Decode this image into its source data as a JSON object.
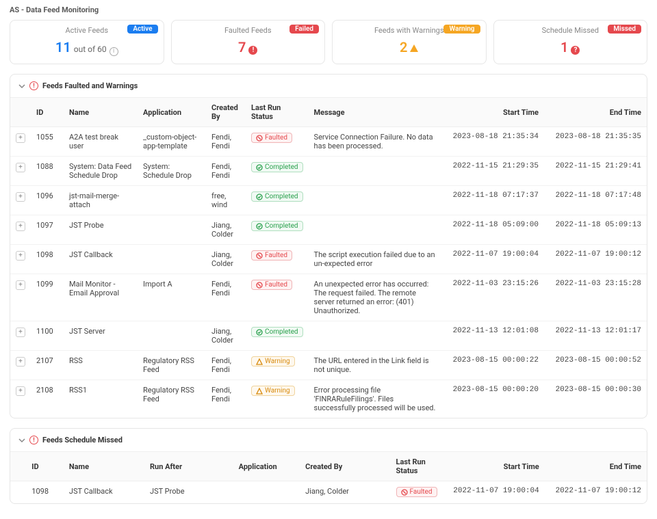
{
  "page_title": "AS - Data Feed Monitoring",
  "stats": {
    "active": {
      "label": "Active Feeds",
      "value": "11",
      "suffix": "out of 60",
      "badge": "Active"
    },
    "faulted": {
      "label": "Faulted Feeds",
      "value": "7",
      "badge": "Failed"
    },
    "warning": {
      "label": "Feeds with Warnings",
      "value": "2",
      "badge": "Warning"
    },
    "missed": {
      "label": "Schedule Missed",
      "value": "1",
      "badge": "Missed"
    }
  },
  "section1": {
    "title": "Feeds Faulted and Warnings",
    "columns": [
      "ID",
      "Name",
      "Application",
      "Created By",
      "Last Run Status",
      "Message",
      "Start Time",
      "End Time"
    ],
    "rows": [
      {
        "id": "1055",
        "name": "A2A test break user",
        "app": "_custom-object-app-template",
        "by": "Fendi, Fendi",
        "status": "Faulted",
        "msg": "Service Connection Failure. No data has been processed.",
        "start": "2023-08-18 21:35:34",
        "end": "2023-08-18 21:35:35"
      },
      {
        "id": "1088",
        "name": "System: Data Feed Schedule Drop",
        "app": "System: Schedule Drop",
        "by": "Fendi, Fendi",
        "status": "Completed",
        "msg": "",
        "start": "2022-11-15 21:29:35",
        "end": "2022-11-15 21:29:41"
      },
      {
        "id": "1096",
        "name": "jst-mail-merge-attach",
        "app": "",
        "by": "free, wind",
        "status": "Completed",
        "msg": "",
        "start": "2022-11-18 07:17:37",
        "end": "2022-11-18 07:17:48"
      },
      {
        "id": "1097",
        "name": "JST Probe",
        "app": "",
        "by": "Jiang, Colder",
        "status": "Completed",
        "msg": "",
        "start": "2022-11-18 05:09:00",
        "end": "2022-11-18 05:09:13"
      },
      {
        "id": "1098",
        "name": "JST Callback",
        "app": "",
        "by": "Jiang, Colder",
        "status": "Faulted",
        "msg": "The script execution failed due to an un-expected error",
        "start": "2022-11-07 19:00:04",
        "end": "2022-11-07 19:00:12"
      },
      {
        "id": "1099",
        "name": "Mail Monitor - Email Approval",
        "app": "Import A",
        "by": "Fendi, Fendi",
        "status": "Faulted",
        "msg": "An unexpected error has occurred: The request failed. The remote server returned an error: (401) Unauthorized.",
        "start": "2022-11-03 23:15:26",
        "end": "2022-11-03 23:15:28"
      },
      {
        "id": "1100",
        "name": "JST Server",
        "app": "",
        "by": "Jiang, Colder",
        "status": "Completed",
        "msg": "",
        "start": "2022-11-13 12:01:08",
        "end": "2022-11-13 12:01:17"
      },
      {
        "id": "2107",
        "name": "RSS",
        "app": "Regulatory RSS Feed",
        "by": "Fendi, Fendi",
        "status": "Warning",
        "msg": "The URL entered in the Link field is not unique.",
        "start": "2023-08-15 00:00:22",
        "end": "2023-08-15 00:00:52"
      },
      {
        "id": "2108",
        "name": "RSS1",
        "app": "Regulatory RSS Feed",
        "by": "Fendi, Fendi",
        "status": "Warning",
        "msg": "Error processing file 'FINRARuleFilings'. Files successfully processed will be used.",
        "start": "2023-08-15 00:00:20",
        "end": "2023-08-15 00:00:30"
      }
    ]
  },
  "section2": {
    "title": "Feeds Schedule Missed",
    "columns": [
      "ID",
      "Name",
      "Run After",
      "Application",
      "Created By",
      "Last Run Status",
      "Start Time",
      "End Time"
    ],
    "rows": [
      {
        "id": "1098",
        "name": "JST Callback",
        "runafter": "JST Probe",
        "app": "",
        "by": "Jiang, Colder",
        "status": "Faulted",
        "start": "2022-11-07 19:00:04",
        "end": "2022-11-07 19:00:12"
      }
    ]
  }
}
